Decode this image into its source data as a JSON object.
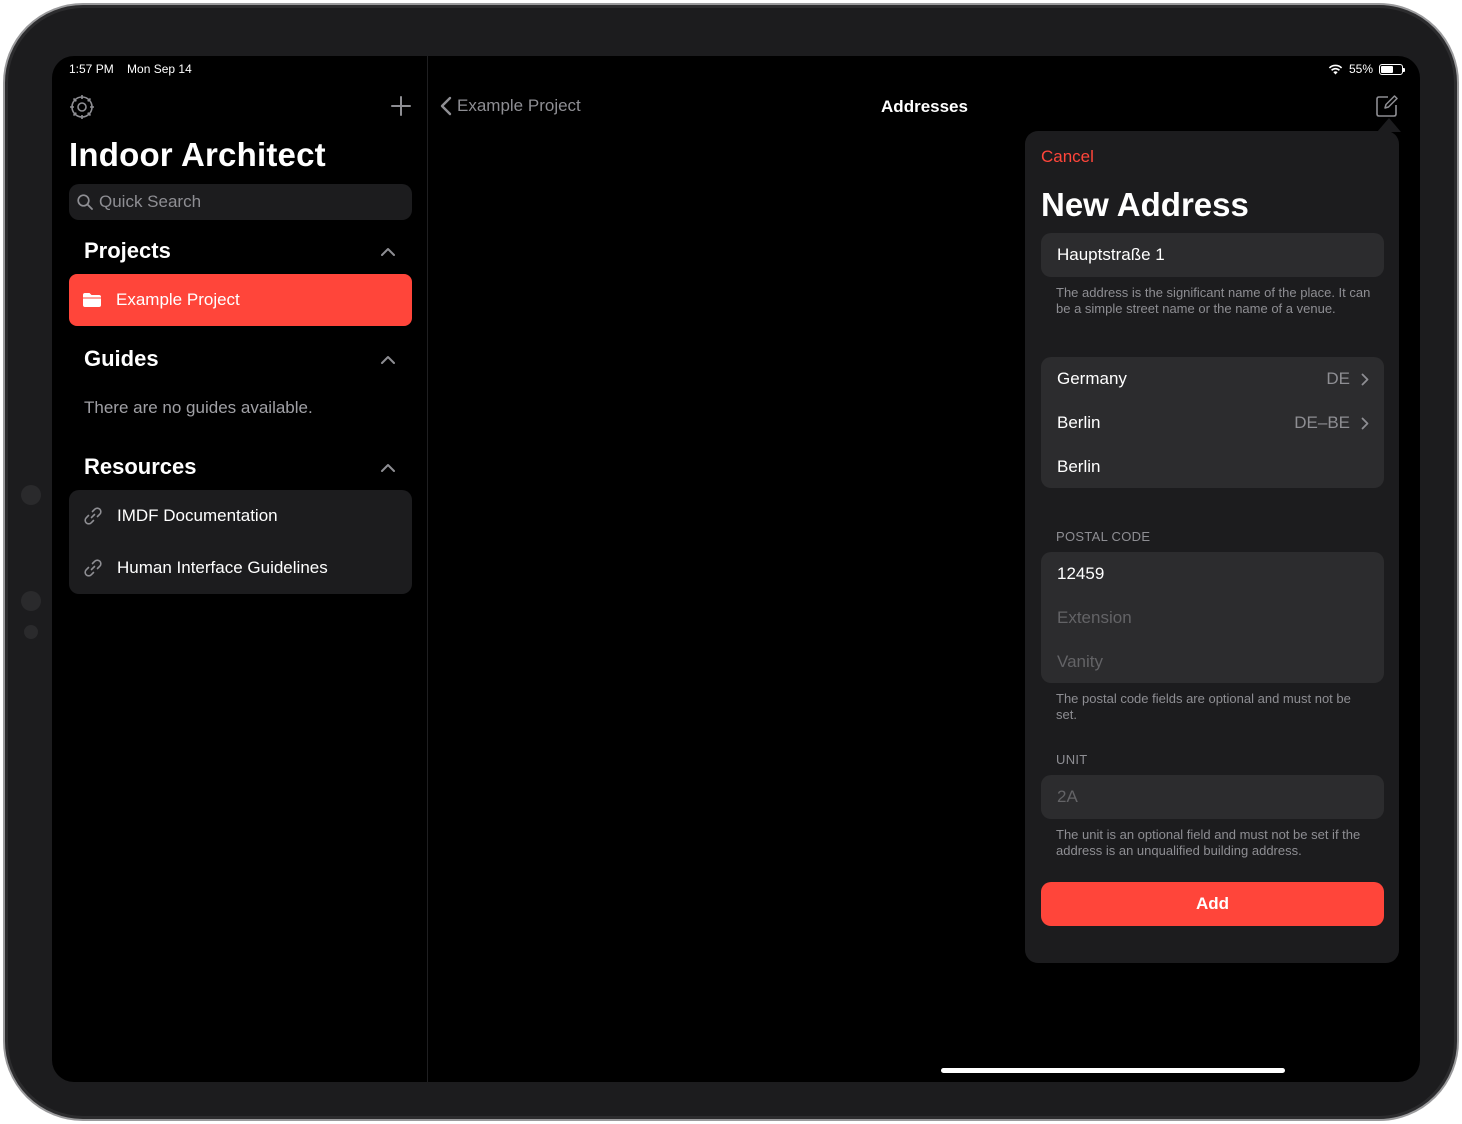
{
  "status": {
    "time": "1:57 PM",
    "date": "Mon Sep 14",
    "battery": "55%"
  },
  "sidebar": {
    "title": "Indoor Architect",
    "search_placeholder": "Quick Search",
    "projects_header": "Projects",
    "projects": [
      {
        "label": "Example Project"
      }
    ],
    "guides_header": "Guides",
    "guides_empty": "There are no guides available.",
    "resources_header": "Resources",
    "resources": [
      {
        "label": "IMDF Documentation"
      },
      {
        "label": "Human Interface Guidelines"
      }
    ]
  },
  "detail": {
    "back_label": "Example Project",
    "title": "Addresses"
  },
  "popover": {
    "cancel_label": "Cancel",
    "title": "New Address",
    "address_value": "Hauptstraße 1",
    "address_footnote": "The address is the significant name of the place. It can be a simple street name or the name of a venue.",
    "country": {
      "label": "Germany",
      "code": "DE"
    },
    "province": {
      "label": "Berlin",
      "code": "DE–BE"
    },
    "locality": "Berlin",
    "postal_header": "POSTAL CODE",
    "postal_code": "12459",
    "extension_placeholder": "Extension",
    "vanity_placeholder": "Vanity",
    "postal_footnote": "The postal code fields are optional and must not be set.",
    "unit_header": "UNIT",
    "unit_placeholder": "2A",
    "unit_footnote": "The unit is an optional field and must not be set if the address is an unqualified building address.",
    "add_label": "Add"
  },
  "colors": {
    "accent": "#ff453a",
    "background": "#000000",
    "grouped": "#1c1c1e",
    "field": "#2c2c2e"
  }
}
